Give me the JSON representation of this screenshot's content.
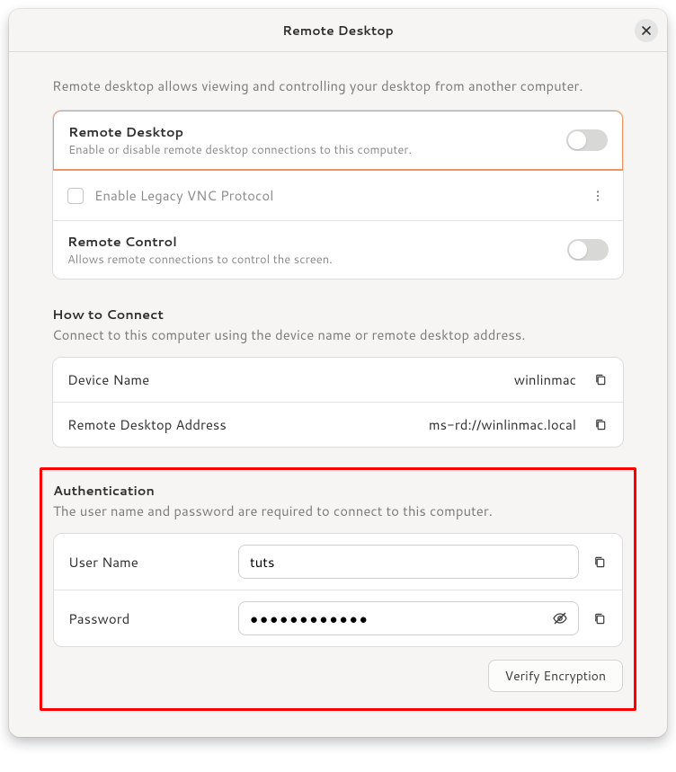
{
  "titlebar": {
    "title": "Remote Desktop"
  },
  "intro": "Remote desktop allows viewing and controlling your desktop from another computer.",
  "settings": {
    "remoteDesktop": {
      "title": "Remote Desktop",
      "sub": "Enable or disable remote desktop connections to this computer."
    },
    "legacyVnc": {
      "label": "Enable Legacy VNC Protocol"
    },
    "remoteControl": {
      "title": "Remote Control",
      "sub": "Allows remote connections to control the screen."
    }
  },
  "howto": {
    "heading": "How to Connect",
    "desc": "Connect to this computer using the device name or remote desktop address.",
    "deviceNameLabel": "Device Name",
    "deviceNameValue": "winlinmac",
    "addressLabel": "Remote Desktop Address",
    "addressValue": "ms-rd://winlinmac.local"
  },
  "auth": {
    "heading": "Authentication",
    "desc": "The user name and password are required to connect to this computer.",
    "userLabel": "User Name",
    "userValue": "tuts",
    "pwLabel": "Password",
    "pwValue": "●●●●●●●●●●●●",
    "verifyLabel": "Verify Encryption"
  }
}
